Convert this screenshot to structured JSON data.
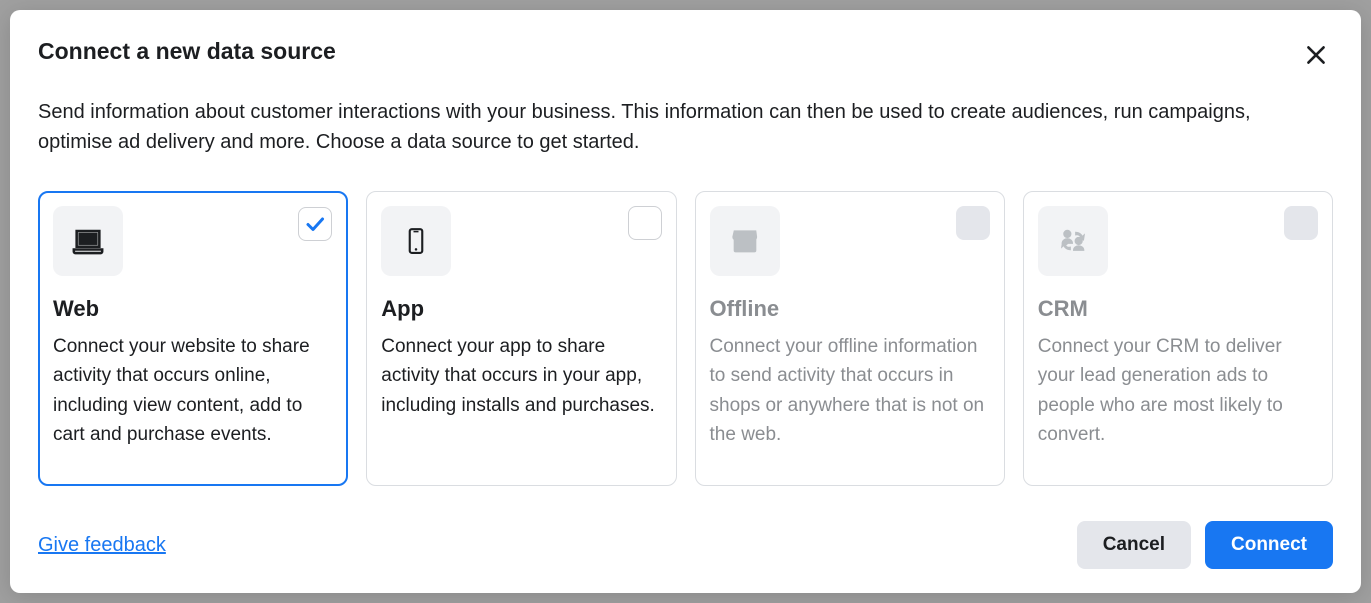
{
  "modal": {
    "title": "Connect a new data source",
    "description": "Send information about customer interactions with your business. This information can then be used to create audiences, run campaigns, optimise ad delivery and more. Choose a data source to get started."
  },
  "cards": [
    {
      "id": "web",
      "title": "Web",
      "description": "Connect your website to share activity that occurs online, including view content, add to cart and purchase events.",
      "selected": true,
      "disabled": false,
      "icon": "laptop-icon"
    },
    {
      "id": "app",
      "title": "App",
      "description": "Connect your app to share activity that occurs in your app, including installs and purchases.",
      "selected": false,
      "disabled": false,
      "icon": "phone-icon"
    },
    {
      "id": "offline",
      "title": "Offline",
      "description": "Connect your offline information to send activity that occurs in shops or anywhere that is not on the web.",
      "selected": false,
      "disabled": true,
      "icon": "store-icon"
    },
    {
      "id": "crm",
      "title": "CRM",
      "description": "Connect your CRM to deliver your lead generation ads to people who are most likely to convert.",
      "selected": false,
      "disabled": true,
      "icon": "people-sync-icon"
    }
  ],
  "footer": {
    "feedback_label": "Give feedback",
    "cancel_label": "Cancel",
    "connect_label": "Connect"
  },
  "colors": {
    "primary": "#1877f2",
    "text": "#1c1e21",
    "disabled_text": "#8a8d91",
    "border": "#dadde1"
  }
}
